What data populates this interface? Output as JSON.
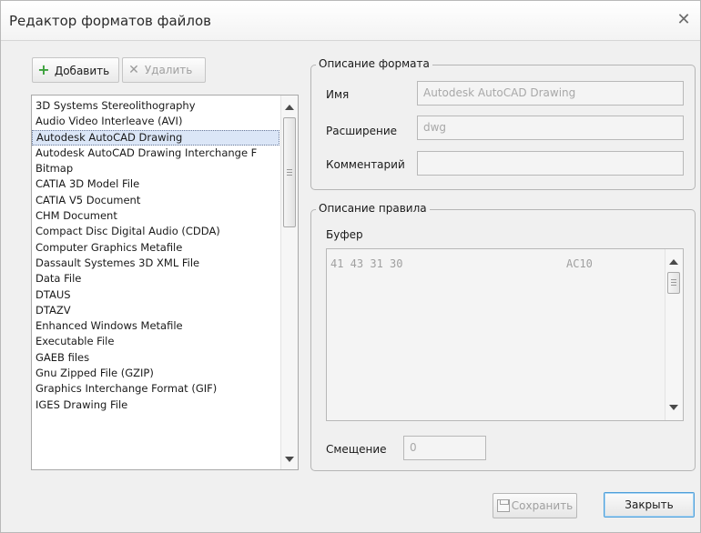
{
  "window": {
    "title": "Редактор форматов файлов",
    "close_glyph": "✕"
  },
  "toolbar": {
    "add_label": "Добавить",
    "add_icon": "plus-icon",
    "delete_label": "Удалить",
    "delete_icon": "x-icon"
  },
  "format_list": {
    "items": [
      "3D Systems Stereolithography",
      "Audio Video Interleave (AVI)",
      "Autodesk AutoCAD Drawing",
      "Autodesk AutoCAD Drawing Interchange F",
      "Bitmap",
      "CATIA 3D Model File",
      "CATIA V5 Document",
      "CHM Document",
      "Compact Disc Digital Audio (CDDA)",
      "Computer Graphics Metafile",
      "Dassault Systemes 3D XML File",
      "Data File",
      "DTAUS",
      "DTAZV",
      "Enhanced Windows Metafile",
      "Executable File",
      "GAEB files",
      "Gnu Zipped File (GZIP)",
      "Graphics Interchange Format (GIF)",
      "IGES Drawing File"
    ],
    "selected_index": 2
  },
  "format_group": {
    "legend": "Описание формата",
    "name_label": "Имя",
    "name_value": "Autodesk AutoCAD Drawing",
    "ext_label": "Расширение",
    "ext_value": "dwg",
    "comment_label": "Комментарий",
    "comment_value": ""
  },
  "rule_group": {
    "legend": "Описание правила",
    "buffer_label": "Буфер",
    "buffer_hex": "41 43 31 30",
    "buffer_ascii": "AC10",
    "offset_label": "Смещение",
    "offset_value": "0"
  },
  "footer": {
    "save_label": "Сохранить",
    "save_icon": "floppy-disk-icon",
    "close_label": "Закрыть"
  },
  "colors": {
    "selection": "#dbe6f7",
    "add_icon": "#3ba13b",
    "close_focus": "#4f9fd9"
  }
}
